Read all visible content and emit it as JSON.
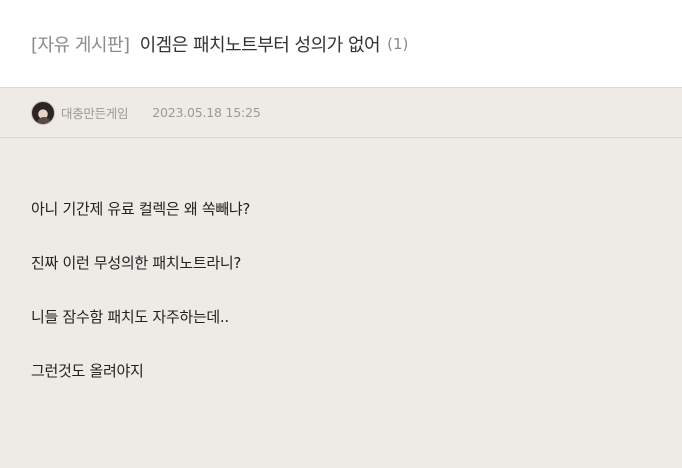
{
  "post": {
    "board_tag": "[자유 게시판]",
    "title": "이겜은 패치노트부터 성의가 없어",
    "comment_count": "(1)"
  },
  "meta": {
    "author": "대충만든게임",
    "date": "2023.05.18 15:25",
    "avatar_icon": "user-avatar-icon"
  },
  "body": {
    "lines": [
      "아니 기간제 유료 컬렉은 왜 쏙빼냐?",
      "진짜 이런 무성의한 패치노트라니?",
      "니들 잠수함 패치도 자주하는데..",
      "그런것도 올려야지"
    ]
  },
  "colors": {
    "background": "#eeebe6",
    "header_background": "#ffffff",
    "muted_text": "#8b8b8b",
    "body_text": "#222222",
    "divider": "#dcd8d2"
  }
}
